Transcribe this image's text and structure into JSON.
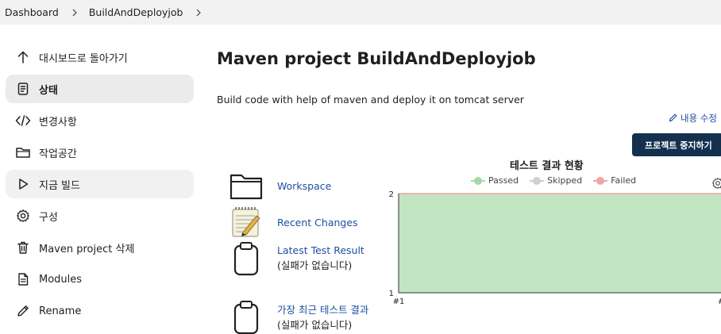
{
  "breadcrumb": {
    "items": [
      "Dashboard",
      "BuildAndDeployjob"
    ]
  },
  "sidebar": {
    "items": [
      {
        "label": "대시보드로 돌아가기",
        "icon": "arrow-up-icon"
      },
      {
        "label": "상태",
        "icon": "document-icon"
      },
      {
        "label": "변경사항",
        "icon": "code-icon"
      },
      {
        "label": "작업공간",
        "icon": "folder-icon"
      },
      {
        "label": "지금 빌드",
        "icon": "play-icon"
      },
      {
        "label": "구성",
        "icon": "gear-icon"
      },
      {
        "label": "Maven project 삭제",
        "icon": "trash-icon"
      },
      {
        "label": "Modules",
        "icon": "document-lines-icon"
      },
      {
        "label": "Rename",
        "icon": "pencil-icon"
      }
    ]
  },
  "main": {
    "title": "Maven project BuildAndDeployjob",
    "description": "Build code with help of maven and deploy it on tomcat server",
    "edit_label": "내용 수정",
    "stop_label": "프로젝트 중지하기",
    "links": {
      "workspace": "Workspace",
      "recent_changes": "Recent Changes",
      "latest_test_link": "Latest Test Result",
      "latest_test_suffix": "(실패가 없습니다)",
      "recent_test_link": "가장 최근 테스트 결과",
      "recent_test_suffix": "(실패가 없습니다)"
    }
  },
  "chart_data": {
    "type": "area",
    "title": "테스트 결과 현황",
    "categories": [
      "#1",
      "#"
    ],
    "series": [
      {
        "name": "Passed",
        "values": [
          2,
          2
        ],
        "color": "#c2e5c2"
      },
      {
        "name": "Skipped",
        "values": [
          0,
          0
        ],
        "color": "#cfcfcf"
      },
      {
        "name": "Failed",
        "values": [
          0,
          0
        ],
        "color": "#f0a4a4"
      }
    ],
    "ylim": [
      1,
      2
    ],
    "yticks": [
      "2",
      "1"
    ],
    "xticks": [
      "#1",
      "#"
    ],
    "legend": "top"
  }
}
